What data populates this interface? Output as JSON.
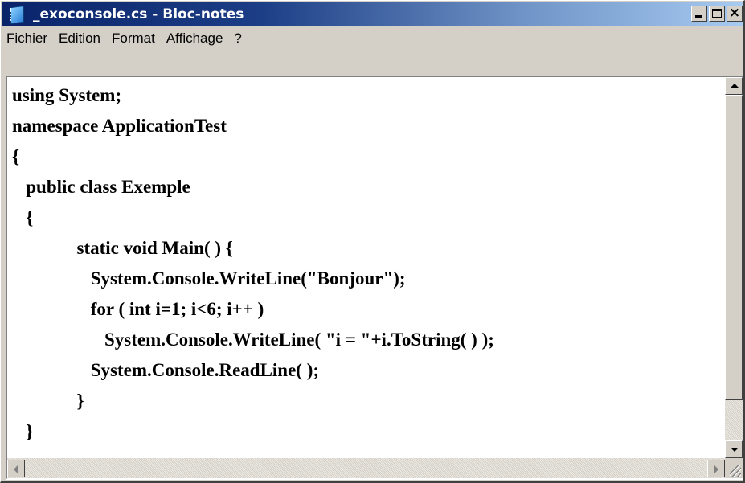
{
  "window": {
    "title": "_exoconsole.cs - Bloc-notes",
    "app_icon": "notepad-icon",
    "buttons": {
      "minimize": "minimize-icon",
      "maximize": "maximize-icon",
      "close": "×"
    }
  },
  "menubar": {
    "items": [
      "Fichier",
      "Edition",
      "Format",
      "Affichage",
      "?"
    ]
  },
  "editor": {
    "lines": [
      "using System;",
      "namespace ApplicationTest",
      "{",
      "   public class Exemple",
      "   {",
      "              static void Main( ) {",
      "                 System.Console.WriteLine(\"Bonjour\");",
      "                 for ( int i=1; i<6; i++ )",
      "                    System.Console.WriteLine( \"i = \"+i.ToString( ) );",
      "                 System.Console.ReadLine( );",
      "              }",
      "   }"
    ]
  },
  "colors": {
    "title_gradient_start": "#0a246a",
    "title_gradient_end": "#a6caf0",
    "chrome": "#d4d0c8",
    "editor_bg": "#ffffff"
  }
}
